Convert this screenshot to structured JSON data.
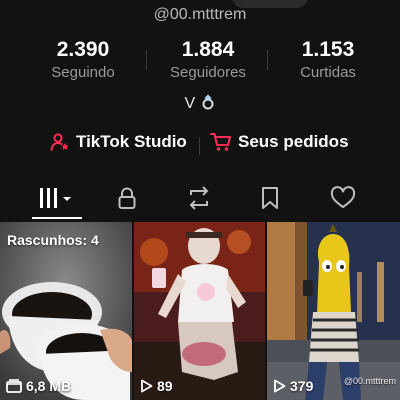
{
  "profile": {
    "username": "@00.mtttrem",
    "bio": "V",
    "bio_emoji": "ring-icon"
  },
  "stats": [
    {
      "value": "2.390",
      "label": "Seguindo"
    },
    {
      "value": "1.884",
      "label": "Seguidores"
    },
    {
      "value": "1.153",
      "label": "Curtidas"
    }
  ],
  "links": {
    "studio_label": "TikTok Studio",
    "orders_label": "Seus pedidos"
  },
  "tabs": [
    "videos-grid-icon",
    "lock-icon",
    "repost-icon",
    "bookmark-icon",
    "heart-icon"
  ],
  "grid": {
    "drafts_label": "Rascunhos: 4",
    "items": [
      {
        "stat": "6,8 MB",
        "icon": "folder-icon"
      },
      {
        "stat": "89",
        "icon": "play-icon"
      },
      {
        "stat": "379",
        "icon": "play-icon",
        "watermark": "@00.mtttrem"
      }
    ]
  },
  "colors": {
    "background": "#121212",
    "accent_red": "#fe2c55"
  }
}
